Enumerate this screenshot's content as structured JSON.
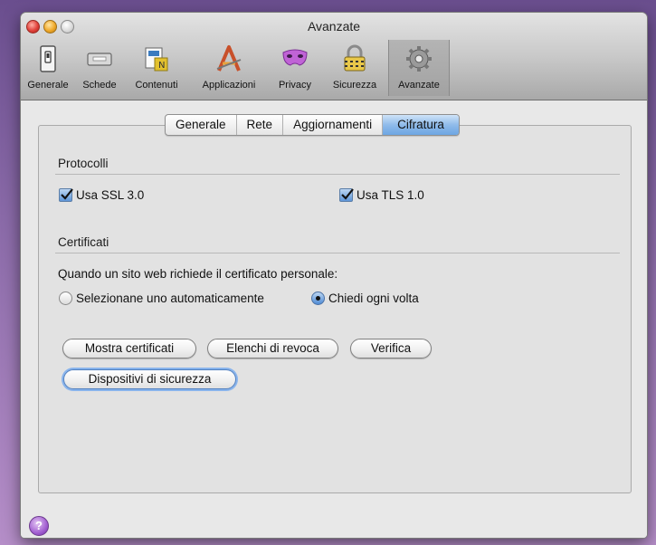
{
  "window": {
    "title": "Avanzate"
  },
  "toolbar": {
    "items": [
      {
        "label": "Generale",
        "icon": "switch-icon"
      },
      {
        "label": "Schede",
        "icon": "tabs-icon"
      },
      {
        "label": "Contenuti",
        "icon": "content-icon"
      },
      {
        "label": "Applicazioni",
        "icon": "applications-icon"
      },
      {
        "label": "Privacy",
        "icon": "privacy-mask-icon"
      },
      {
        "label": "Sicurezza",
        "icon": "lock-icon"
      },
      {
        "label": "Avanzate",
        "icon": "gear-icon"
      }
    ],
    "selected": "Avanzate"
  },
  "tabs": {
    "items": [
      "Generale",
      "Rete",
      "Aggiornamenti",
      "Cifratura"
    ],
    "active": "Cifratura"
  },
  "protocolli": {
    "heading": "Protocolli",
    "ssl_label": "Usa SSL 3.0",
    "ssl_checked": true,
    "tls_label": "Usa TLS 1.0",
    "tls_checked": true
  },
  "certificati": {
    "heading": "Certificati",
    "prompt": "Quando un sito web richiede il certificato personale:",
    "option_auto": "Selezionane uno automaticamente",
    "option_ask": "Chiedi ogni volta",
    "selected": "Chiedi ogni volta"
  },
  "buttons": {
    "show_certs": "Mostra certificati",
    "revocation": "Elenchi di revoca",
    "verify": "Verifica",
    "devices": "Dispositivi di sicurezza"
  },
  "help": {
    "glyph": "?"
  },
  "colors": {
    "accent": "#6da6e3",
    "help": "#a25fd1"
  }
}
